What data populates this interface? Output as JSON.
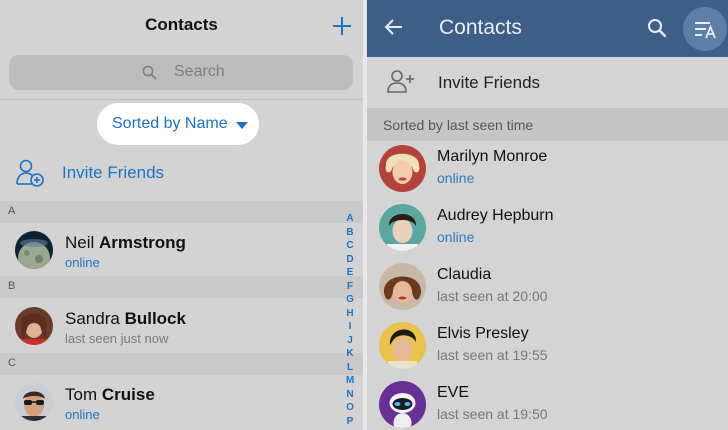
{
  "ios": {
    "title": "Contacts",
    "search_placeholder": "Search",
    "sort_label": "Sorted by Name",
    "invite_label": "Invite Friends",
    "sections": [
      "A",
      "B",
      "C"
    ],
    "contacts": [
      {
        "first": "Neil",
        "last": "Armstrong",
        "status": "online",
        "online": true,
        "avatar": "moon"
      },
      {
        "first": "Sandra",
        "last": "Bullock",
        "status": "last seen just now",
        "online": false,
        "avatar": "sandra"
      },
      {
        "first": "Tom",
        "last": "Cruise",
        "status": "online",
        "online": true,
        "avatar": "tom"
      }
    ],
    "index_letters": [
      "A",
      "B",
      "C",
      "D",
      "E",
      "F",
      "G",
      "H",
      "I",
      "J",
      "K",
      "L",
      "M",
      "N",
      "O",
      "P"
    ],
    "accent": "#1a73c6"
  },
  "android": {
    "title": "Contacts",
    "invite_label": "Invite Friends",
    "sort_header": "Sorted by last seen time",
    "contacts": [
      {
        "name": "Marilyn Monroe",
        "status": "online",
        "online": true,
        "avatar": "marilyn"
      },
      {
        "name": "Audrey Hepburn",
        "status": "online",
        "online": true,
        "avatar": "audrey"
      },
      {
        "name": "Claudia",
        "status": "last seen at 20:00",
        "online": false,
        "avatar": "claudia"
      },
      {
        "name": "Elvis Presley",
        "status": "last seen at 19:55",
        "online": false,
        "avatar": "elvis"
      },
      {
        "name": "EVE",
        "status": "last seen at 19:50",
        "online": false,
        "avatar": "eve"
      }
    ],
    "appbar_color": "#3d5f86",
    "accent": "#2f79c0"
  }
}
